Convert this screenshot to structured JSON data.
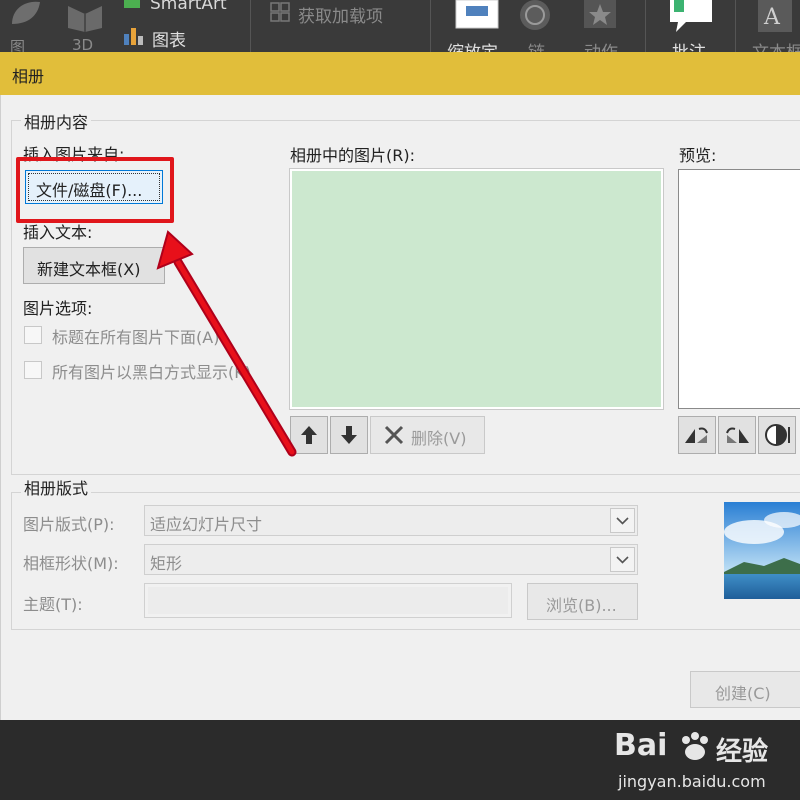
{
  "ribbon": {
    "smartart_label": "SmartArt",
    "chart_label": "图表",
    "addins_label": "获取加载项",
    "left_partial_1": "图",
    "left_partial_2": "3D",
    "zoom_label": "缩放定",
    "link_label": "链",
    "action_label": "动作",
    "comment_label": "批注",
    "textbox_label": "文本框"
  },
  "dialog": {
    "title": "相册",
    "content_group": {
      "legend": "相册内容",
      "insert_picture_from": "插入图片来自:",
      "file_disk_button": "文件/磁盘(F)...",
      "insert_text": "插入文本:",
      "new_textbox_button": "新建文本框(X)",
      "picture_options": "图片选项:",
      "option_captions": "标题在所有图片下面(A)",
      "option_bw": "所有图片以黑白方式显示(K)",
      "pictures_in_album": "相册中的图片(R):",
      "preview": "预览:",
      "remove_button": "删除(V)"
    },
    "layout_group": {
      "legend": "相册版式",
      "picture_layout_label": "图片版式(P):",
      "picture_layout_value": "适应幻灯片尺寸",
      "frame_shape_label": "相框形状(M):",
      "frame_shape_value": "矩形",
      "theme_label": "主题(T):",
      "theme_value": "",
      "browse_button": "浏览(B)..."
    },
    "create_button": "创建(C)"
  },
  "watermark": {
    "brand": "Bai",
    "brand2": "经验",
    "url": "jingyan.baidu.com"
  },
  "colors": {
    "titlebar": "#e1be3a",
    "listbox": "#cce8cf",
    "highlight": "#e0161b",
    "ribbon": "#3a3a3a"
  }
}
